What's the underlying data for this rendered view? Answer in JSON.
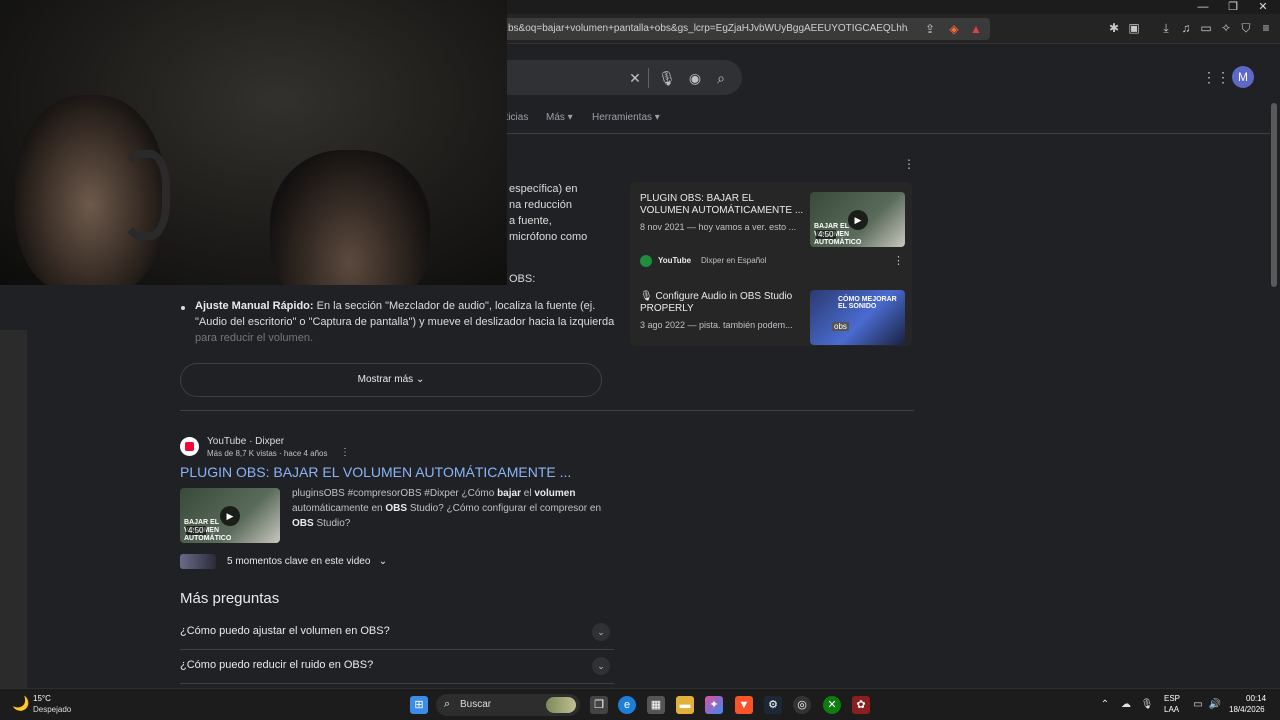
{
  "browser": {
    "url": "bs&oq=bajar+volumen+pantalla+obs&gs_lcrp=EgZjaHJvbWUyBggAEEUYOTIGCAEQLhhAMgYIAh..."
  },
  "google": {
    "avatar_letter": "M",
    "tabs": [
      "oticias",
      "Más",
      "Herramientas"
    ]
  },
  "snippet": {
    "lines": [
      "específica) en",
      "na reducción",
      "a fuente,",
      "micrófono como"
    ],
    "obs_fragment": "OBS:",
    "bullet_bold": "Ajuste Manual Rápido:",
    "bullet_text_1": " En la sección \"Mezclador de audio\", localiza la fuente (ej.",
    "bullet_text_2": "\"Audio del escritorio\" o \"Captura de pantalla\") y mueve el deslizador hacia la izquierda",
    "bullet_text_3": "para reducir el volumen.",
    "show_more": "Mostrar más"
  },
  "video_panel": {
    "items": [
      {
        "title": "PLUGIN OBS: BAJAR EL VOLUMEN AUTOMÁTICAMENTE ...",
        "meta": "8 nov 2021 — hoy vamos a ver. esto ...",
        "duration": "4:50",
        "source": "YouTube",
        "channel": "Dixper en Español",
        "thumb_text": "BAJAR EL VOLUMEN AUTOMÁTICO"
      },
      {
        "title": "Configure Audio in OBS Studio PROPERLY",
        "meta": "3 ago 2022 — pista. también podem...",
        "thumb_text": "CÓMO MEJORAR EL SONIDO",
        "thumb_badge": "obs"
      }
    ]
  },
  "result": {
    "source": "YouTube · Dixper",
    "stats": "Más de 8,7 K vistas · hace 4 años",
    "title": "PLUGIN OBS: BAJAR EL VOLUMEN AUTOMÁTICAMENTE ...",
    "description_1": "pluginsOBS #compresorOBS #Dixper ¿Cómo ",
    "description_bold_1": "bajar",
    "description_2": " el ",
    "description_bold_2": "volumen",
    "description_3": " automáticamente en ",
    "description_bold_3": "OBS",
    "description_4": " Studio? ¿Cómo configurar el compresor en ",
    "description_bold_4": "OBS",
    "description_5": " Studio?",
    "duration": "4:50",
    "thumb_text": "BAJAR EL VOLUMEN AUTOMÁTICO",
    "key_moments": "5 momentos clave en este video"
  },
  "more_questions": {
    "heading": "Más preguntas",
    "items": [
      "¿Cómo puedo ajustar el volumen en OBS?",
      "¿Cómo puedo reducir el ruido en OBS?"
    ]
  },
  "taskbar": {
    "weather_temp": "15°C",
    "weather_desc": "Despejado",
    "search_placeholder": "Buscar",
    "lang_1": "ESP",
    "lang_2": "LAA",
    "time": "00:14",
    "date": "18/4/2026"
  },
  "colors": {
    "link": "#8ab4f8",
    "page_bg": "#202124",
    "avatar": "#5e68c6"
  }
}
